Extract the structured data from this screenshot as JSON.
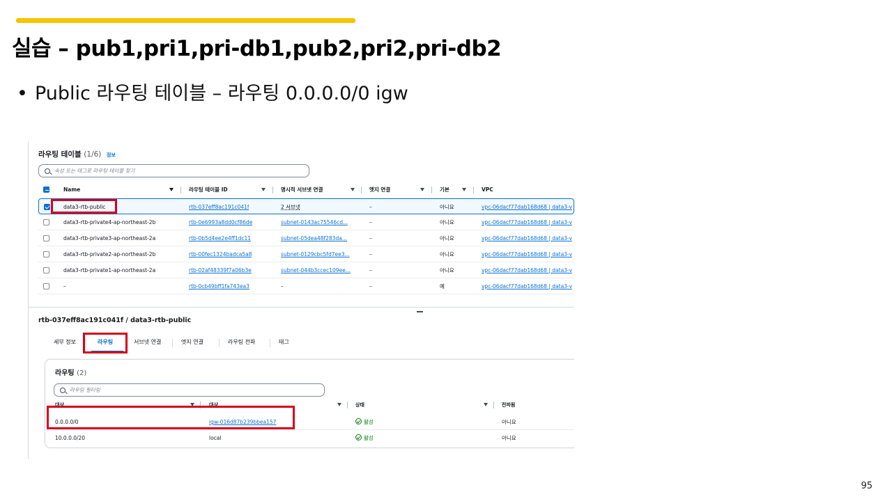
{
  "slide": {
    "title": "실습 – pub1,pri1,pri-db1,pub2,pri2,pri-db2",
    "bullet": "Public 라우팅 테이블 – 라우팅 0.0.0.0/0 igw",
    "page_number": "95",
    "accent_color": "#f7c400",
    "highlight_color": "#d6001c"
  },
  "route_tables": {
    "title": "라우팅 테이블",
    "count": "(1/6)",
    "info_link": "정보",
    "search_placeholder": "속성 또는 태그로 라우팅 테이블 찾기",
    "columns": [
      "Name",
      "라우팅 테이블 ID",
      "명시적 서브넷 연결",
      "엣지 연결",
      "기본",
      "VPC"
    ],
    "rows": [
      {
        "name": "data3-rtb-public",
        "id": "rtb-037eff8ac191c041f",
        "subnet": "2 서브넷",
        "edge": "–",
        "main": "아니요",
        "vpc": "vpc-06dacf77dab168d68 | data3-v",
        "selected": true
      },
      {
        "name": "data3-rtb-private4-ap-northeast-2b",
        "id": "rtb-0e6993a8dd0cf86de",
        "subnet": "subnet-0143ac75546cd...",
        "edge": "–",
        "main": "아니요",
        "vpc": "vpc-06dacf77dab168d68 | data3-v",
        "selected": false
      },
      {
        "name": "data3-rtb-private3-ap-northeast-2a",
        "id": "rtb-0b5d4ee2e4ff1dc11",
        "subnet": "subnet-05dea48f283da...",
        "edge": "–",
        "main": "아니요",
        "vpc": "vpc-06dacf77dab168d68 | data3-v",
        "selected": false
      },
      {
        "name": "data3-rtb-private2-ap-northeast-2b",
        "id": "rtb-00fec1324badca5a8",
        "subnet": "subnet-0129cbc5fd7ee3...",
        "edge": "–",
        "main": "아니요",
        "vpc": "vpc-06dacf77dab168d68 | data3-v",
        "selected": false
      },
      {
        "name": "data3-rtb-private1-ap-northeast-2a",
        "id": "rtb-02af48339f7a06b3e",
        "subnet": "subnet-044b3ccec109ee...",
        "edge": "–",
        "main": "아니요",
        "vpc": "vpc-06dacf77dab168d68 | data3-v",
        "selected": false
      },
      {
        "name": "–",
        "id": "rtb-0cb49bff1fa743ea3",
        "subnet": "–",
        "edge": "–",
        "main": "예",
        "vpc": "vpc-06dacf77dab168d68 | data3-v",
        "selected": false
      }
    ]
  },
  "detail": {
    "title": "rtb-037eff8ac191c041f / data3-rtb-public",
    "tabs": [
      "세부 정보",
      "라우팅",
      "서브넷 연결",
      "엣지 연결",
      "라우팅 전파",
      "태그"
    ],
    "active_tab": "라우팅"
  },
  "routes": {
    "title": "라우팅",
    "count": "(2)",
    "filter_placeholder": "라우팅 필터링",
    "columns": [
      "대상",
      "대상",
      "상태",
      "전파됨"
    ],
    "rows": [
      {
        "destination": "0.0.0.0/0",
        "target": "igw-016d87b239bbea157",
        "target_is_link": true,
        "status": "활성",
        "propagated": "아니요"
      },
      {
        "destination": "10.0.0.0/20",
        "target": "local",
        "target_is_link": false,
        "status": "활성",
        "propagated": "아니요"
      }
    ]
  }
}
